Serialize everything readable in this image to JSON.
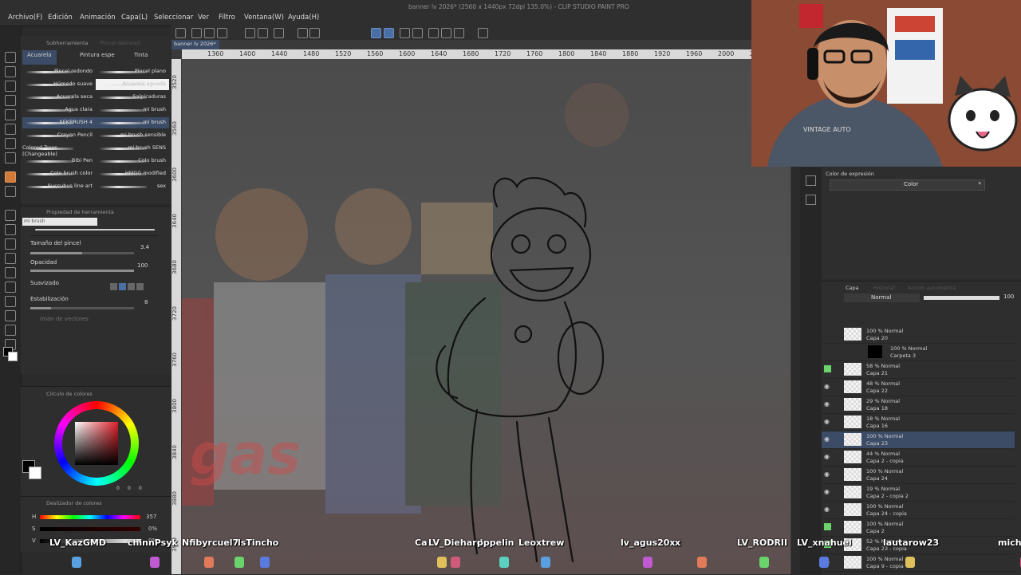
{
  "window": {
    "title": "banner lv 2026* (2560 x 1440px 72dpi 135.0%) - CLIP STUDIO PAINT PRO"
  },
  "menu": [
    "Archivo(F)",
    "Edición",
    "Animación",
    "Capa(L)",
    "Seleccionar",
    "Ver",
    "Filtro",
    "Ventana(W)",
    "Ayuda(H)"
  ],
  "canvas_tab": "banner lv 2026*",
  "subtool": {
    "header_tabs": [
      "Subherramienta",
      "Pincel delinead"
    ],
    "tabs": [
      "Acuarela",
      "Pintura espe",
      "Tinta"
    ],
    "brushes_left": [
      "Pincel redondo",
      "Húmedo suave",
      "Acuarela seca",
      "Agua clara",
      "SEKBRUSH 4",
      "Crayon Pencil",
      "Colored Trees (Changeable)",
      "Bibi Pen",
      "Colo brush color",
      "Succubus line art"
    ],
    "brushes_right": [
      "Pincel plano",
      "Acuarela aguada",
      "Salpicaduras",
      "mi brush",
      "mi brush",
      "mi brush sensible",
      "mi brush SENS",
      "Colo brush",
      "HMGG modified",
      "sex"
    ]
  },
  "tool_property": {
    "header": "Propiedad de herramienta",
    "brush_name": "mi brush",
    "size_label": "Tamaño del pincel",
    "size_value": "3.4",
    "opacity_label": "Opacidad",
    "opacity_value": "100",
    "smooth_label": "Suavizado",
    "stab_label": "Estabilización",
    "stab_value": "8",
    "vector_label": "Imán de vectores"
  },
  "color_wheel": {
    "header": "Círculo de colores",
    "ring_values": [
      "0",
      "0",
      "0"
    ]
  },
  "color_slider": {
    "header": "Deslizador de colores",
    "rows": [
      {
        "label": "H",
        "value": "357"
      },
      {
        "label": "S",
        "value": "0%"
      },
      {
        "label": "V",
        "value": "0%"
      }
    ]
  },
  "ruler_h": [
    "1360",
    "1400",
    "1440",
    "1480",
    "1520",
    "1560",
    "1600",
    "1640",
    "1680",
    "1720",
    "1760",
    "1800",
    "1840",
    "1880",
    "1920",
    "1960",
    "2000",
    "2040",
    "2080"
  ],
  "ruler_v": [
    "3520",
    "3560",
    "3600",
    "3640",
    "3680",
    "3720",
    "3760",
    "3800",
    "3840",
    "3880",
    "3920"
  ],
  "color_expression": {
    "header": "Color de expresión",
    "value": "Color"
  },
  "layers": {
    "header_tabs": [
      "Capa",
      "Historial",
      "Acción automática"
    ],
    "blend_mode": "Normal",
    "opacity": "100",
    "items": [
      {
        "pct": "100 % Normal",
        "name": "Capa 20",
        "eye": "none",
        "selected": false
      },
      {
        "pct": "100 % Normal",
        "name": "Carpeta 3",
        "eye": "none",
        "selected": false,
        "folder": true
      },
      {
        "pct": "58 % Normal",
        "name": "Capa 21",
        "eye": "green",
        "selected": false
      },
      {
        "pct": "48 % Normal",
        "name": "Capa 22",
        "eye": "open",
        "selected": false
      },
      {
        "pct": "29 % Normal",
        "name": "Capa 18",
        "eye": "open",
        "selected": false
      },
      {
        "pct": "18 % Normal",
        "name": "Capa 16",
        "eye": "open",
        "selected": false
      },
      {
        "pct": "100 % Normal",
        "name": "Capa 23",
        "eye": "open",
        "selected": true
      },
      {
        "pct": "44 % Normal",
        "name": "Capa 2 - copia",
        "eye": "open",
        "selected": false
      },
      {
        "pct": "100 % Normal",
        "name": "Capa 24",
        "eye": "open",
        "selected": false
      },
      {
        "pct": "19 % Normal",
        "name": "Capa 2 - copia 2",
        "eye": "open",
        "selected": false
      },
      {
        "pct": "100 % Normal",
        "name": "Capa 24 - copia",
        "eye": "open",
        "selected": false
      },
      {
        "pct": "100 % Normal",
        "name": "Capa 2",
        "eye": "green",
        "selected": false
      },
      {
        "pct": "52 % Normal",
        "name": "Capa 23 - copia",
        "eye": "green",
        "selected": false
      },
      {
        "pct": "100 % Normal",
        "name": "Capa 9 - copia",
        "eye": "open",
        "selected": false
      }
    ]
  },
  "chat_nicks": [
    {
      "text": "LV_KazGMD",
      "color": "#ffffff"
    },
    {
      "text": "chinnPsyk",
      "color": "#ffffff"
    },
    {
      "text": "Nfibyr",
      "color": "#ffffff"
    },
    {
      "text": "cuel7",
      "color": "#ffffff"
    },
    {
      "text": "lsTincho",
      "color": "#ffffff"
    },
    {
      "text": "Ca",
      "color": "#ffffff"
    },
    {
      "text": "LV_Diehard",
      "color": "#ffffff"
    },
    {
      "text": "pppelin",
      "color": "#ffffff"
    },
    {
      "text": "Leoxtrew",
      "color": "#ffffff"
    },
    {
      "text": "lv_agus20xx",
      "color": "#ffffff"
    },
    {
      "text": "x",
      "color": "#ffffff"
    },
    {
      "text": "LV_RODRII",
      "color": "#ffffff"
    },
    {
      "text": "LV_xnahuel",
      "color": "#ffffff"
    },
    {
      "text": "lautarow23",
      "color": "#ffffff"
    },
    {
      "text": "mich",
      "color": "#ffffff"
    }
  ],
  "webcam": {
    "shirt_text": "VINTAGE AUTO"
  },
  "colors": {
    "accent": "#3c4c66",
    "selected_tool": "#d07a3a",
    "eye_green": "#6bd36b"
  }
}
